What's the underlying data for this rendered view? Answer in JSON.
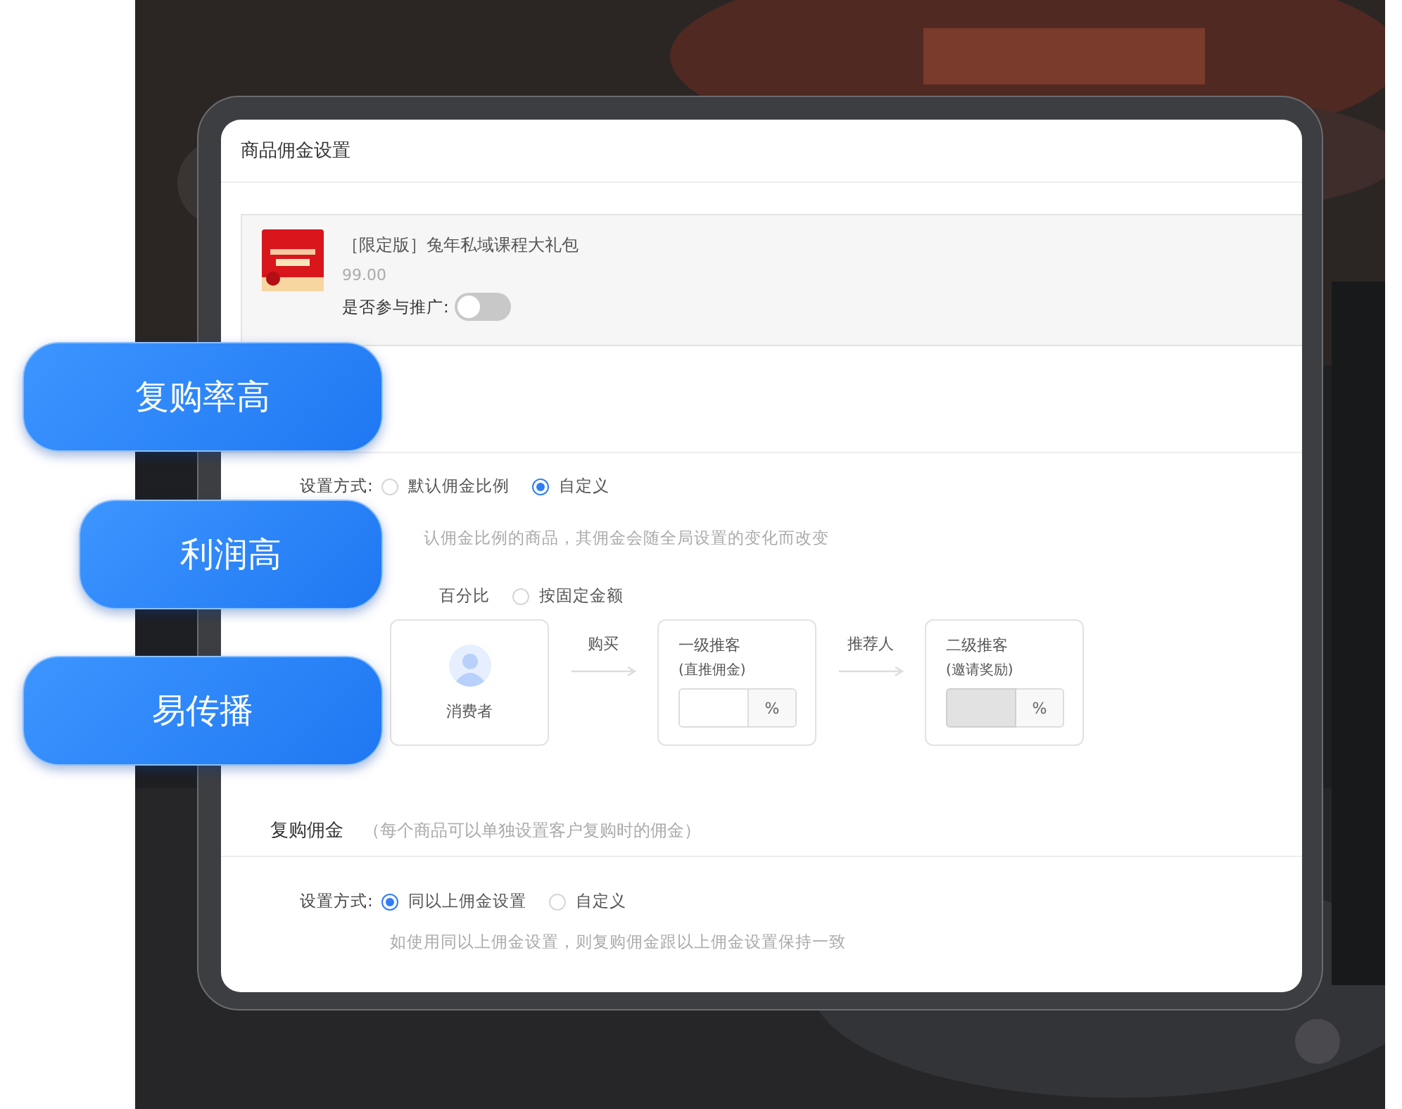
{
  "window": {
    "title": "商品佣金设置"
  },
  "product": {
    "name": "［限定版］兔年私域课程大礼包",
    "price": "99.00",
    "promote_label": "是否参与推广:",
    "promote_on": false
  },
  "commission": {
    "mode_label": "设置方式:",
    "modes": [
      {
        "label": "默认佣金比例",
        "selected": false
      },
      {
        "label": "自定义",
        "selected": true
      }
    ],
    "hint": "认佣金比例的商品，其佣金会随全局设置的变化而改变",
    "type_partial_label": "百分比",
    "types": [
      {
        "label": "按固定金额",
        "selected": false
      }
    ]
  },
  "flow": {
    "consumer": "消费者",
    "arrows": [
      "购买",
      "推荐人"
    ],
    "tiers": [
      {
        "title": "一级推客",
        "subtitle": "(直推佣金)",
        "unit": "%",
        "disabled": false
      },
      {
        "title": "二级推客",
        "subtitle": "(邀请奖励)",
        "unit": "%",
        "disabled": true
      }
    ]
  },
  "repurchase": {
    "title": "复购佣金",
    "note": "（每个商品可以单独设置客户复购时的佣金）",
    "mode_label": "设置方式:",
    "modes": [
      {
        "label": "同以上佣金设置",
        "selected": true
      },
      {
        "label": "自定义",
        "selected": false
      }
    ],
    "hint": "如使用同以上佣金设置，则复购佣金跟以上佣金设置保持一致"
  },
  "tags": [
    {
      "label": "复购率高"
    },
    {
      "label": "利润高"
    },
    {
      "label": "易传播"
    }
  ]
}
